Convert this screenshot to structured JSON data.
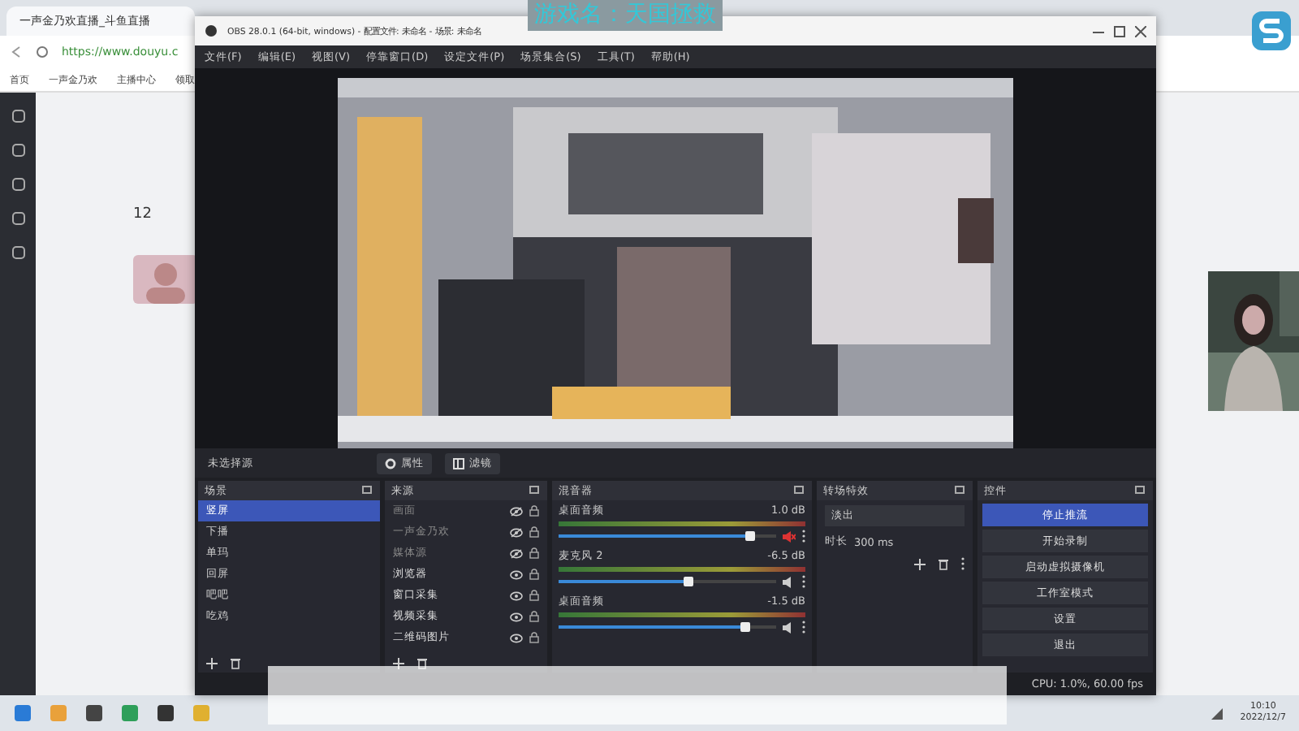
{
  "overlay_title": "游戏名：天国拯救",
  "browser": {
    "tab_title": "一声金乃欢直播_斗鱼直播",
    "url": "https://www.douyu.c",
    "bookmarks": [
      "首页",
      "一声金乃欢",
      "主播中心",
      "领取"
    ]
  },
  "page": {
    "follower_count": "12"
  },
  "obs": {
    "title": "OBS 28.0.1 (64-bit, windows) - 配置文件: 未命名 - 场景: 未命名",
    "menu": [
      "文件(F)",
      "编辑(E)",
      "视图(V)",
      "停靠窗口(D)",
      "设定文件(P)",
      "场景集合(S)",
      "工具(T)",
      "帮助(H)"
    ],
    "source_bar": {
      "label": "未选择源",
      "buttons": [
        {
          "kind": "gear",
          "label": "属性"
        },
        {
          "kind": "filter",
          "label": "滤镜"
        }
      ]
    },
    "scenes": {
      "title": "场景",
      "items": [
        {
          "label": "竖屏",
          "selected": true
        },
        {
          "label": "下播",
          "selected": false
        },
        {
          "label": "单玛",
          "selected": false
        },
        {
          "label": "回屏",
          "selected": false
        },
        {
          "label": "吧吧",
          "selected": false
        },
        {
          "label": "吃鸡",
          "selected": false
        }
      ]
    },
    "sources": {
      "title": "来源",
      "items": [
        {
          "label": "画面",
          "visible": false
        },
        {
          "label": "一声金乃欢",
          "visible": false
        },
        {
          "label": "媒体源",
          "visible": false
        },
        {
          "label": "浏览器",
          "visible": true
        },
        {
          "label": "窗口采集",
          "visible": true
        },
        {
          "label": "视频采集",
          "visible": true
        },
        {
          "label": "二维码图片",
          "visible": true
        }
      ]
    },
    "mixer": {
      "title": "混音器",
      "channels": [
        {
          "name": "桌面音频",
          "reading": "1.0 dB",
          "level": 0.88,
          "muted": true
        },
        {
          "name": "麦克风 2",
          "reading": "-6.5 dB",
          "level": 0.6,
          "muted": false
        },
        {
          "name": "桌面音频",
          "reading": "-1.5 dB",
          "level": 0.86,
          "muted": false
        }
      ]
    },
    "transitions": {
      "title": "转场特效",
      "type": "淡出",
      "duration_label": "时长",
      "duration": "300 ms"
    },
    "controls": {
      "title": "控件",
      "buttons": [
        {
          "label": "停止推流",
          "active": true
        },
        {
          "label": "开始录制",
          "active": false
        },
        {
          "label": "启动虚拟摄像机",
          "active": false
        },
        {
          "label": "工作室模式",
          "active": false
        },
        {
          "label": "设置",
          "active": false
        },
        {
          "label": "退出",
          "active": false
        }
      ]
    },
    "status": "CPU: 1.0%, 60.00 fps"
  },
  "taskbar": {
    "time": "10:10",
    "date": "2022/12/7"
  }
}
